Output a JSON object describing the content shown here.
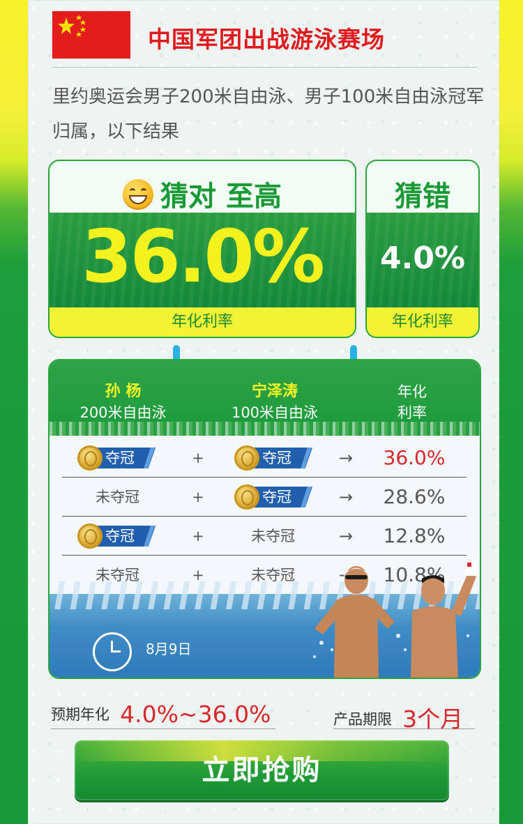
{
  "header": {
    "title": "中国军团出战游泳赛场"
  },
  "intro": "里约奥运会男子200米自由泳、男子100米自由泳冠军归属，以下结果",
  "guess_right": {
    "title": "猜对 至高",
    "rate": "36.0%",
    "label": "年化利率"
  },
  "guess_wrong": {
    "title": "猜错",
    "rate": "4.0%",
    "label": "年化利率"
  },
  "table": {
    "columns": [
      {
        "name": "孙 杨",
        "event": "200米自由泳"
      },
      {
        "name": "宁泽涛",
        "event": "100米自由泳"
      },
      {
        "name": "年化",
        "event": "利率"
      }
    ],
    "win_label": "夺冠",
    "lose_label": "未夺冠",
    "plus": "+",
    "arrow": "→",
    "rows": [
      {
        "a": "夺冠",
        "b": "夺冠",
        "rate": "36.0%",
        "highlight": true
      },
      {
        "a": "未夺冠",
        "b": "夺冠",
        "rate": "28.6%",
        "highlight": false
      },
      {
        "a": "夺冠",
        "b": "未夺冠",
        "rate": "12.8%",
        "highlight": false
      },
      {
        "a": "未夺冠",
        "b": "未夺冠",
        "rate": "10.8%",
        "highlight": false
      }
    ],
    "date": "8月9日"
  },
  "footer": {
    "expected_label": "预期年化",
    "expected_value": "4.0%~36.0%",
    "term_label": "产品期限",
    "term_value": "3个月"
  },
  "cta": "立即抢购",
  "colors": {
    "brand_green": "#1a9a36",
    "accent_yellow": "#f4f21e",
    "red": "#d9262b",
    "tag_blue": "#1f5fae"
  }
}
